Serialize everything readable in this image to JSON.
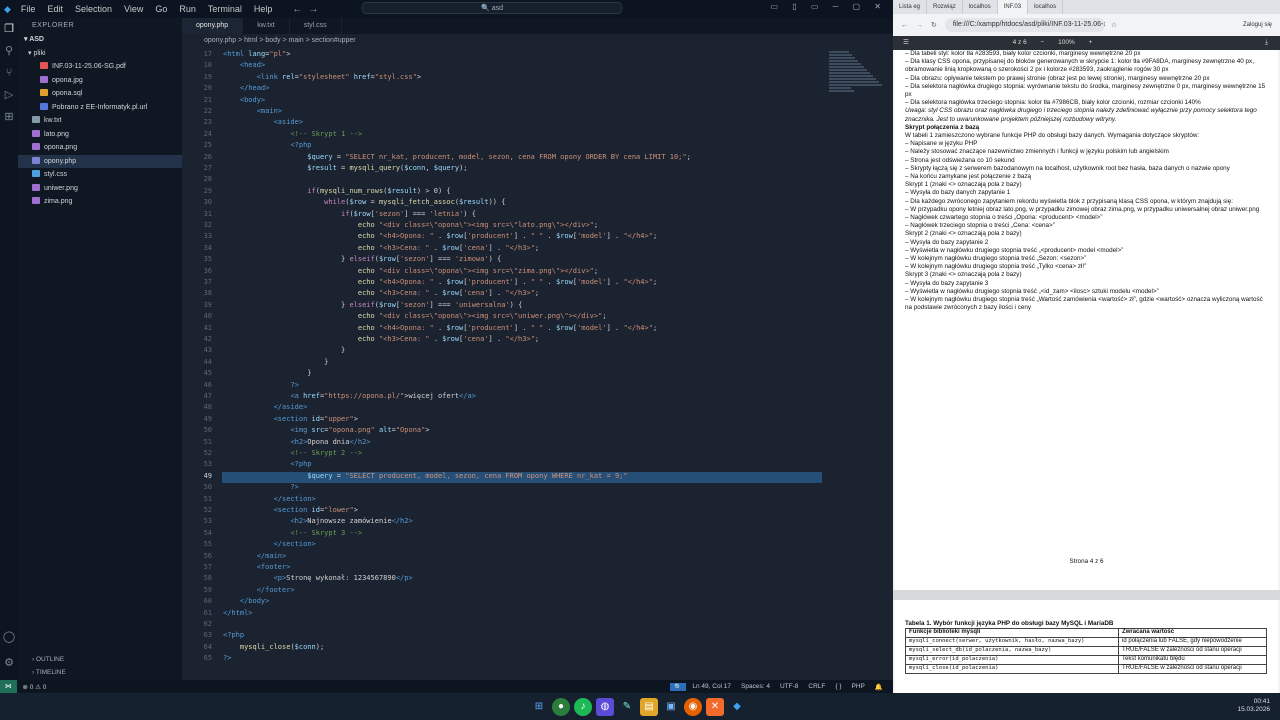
{
  "vscode": {
    "menu": [
      "File",
      "Edit",
      "Selection",
      "View",
      "Go",
      "Run",
      "Terminal",
      "Help"
    ],
    "search_text": "asd",
    "explorer_title": "EXPLORER",
    "workspace": "ASD",
    "folder": "pliki",
    "files": [
      {
        "name": "INF.03-11-25.06-SG.pdf",
        "color": "#e05555",
        "indent": true
      },
      {
        "name": "opona.jpg",
        "color": "#a070d0",
        "indent": true
      },
      {
        "name": "opona.sql",
        "color": "#e0a030",
        "indent": true
      },
      {
        "name": "Pobrano z EE-Informatyk.pl.url",
        "color": "#5577dd",
        "indent": true
      },
      {
        "name": "kw.txt",
        "color": "#8899aa",
        "indent": false
      },
      {
        "name": "lato.png",
        "color": "#a070d0",
        "indent": false
      },
      {
        "name": "opona.png",
        "color": "#a070d0",
        "indent": false
      },
      {
        "name": "opony.php",
        "color": "#7b83d6",
        "indent": false,
        "selected": true
      },
      {
        "name": "styl.css",
        "color": "#4aa0e0",
        "indent": false
      },
      {
        "name": "uniwer.png",
        "color": "#a070d0",
        "indent": false
      },
      {
        "name": "zima.png",
        "color": "#a070d0",
        "indent": false
      }
    ],
    "outline": "OUTLINE",
    "timeline": "TIMELINE",
    "tabs": [
      {
        "label": "opony.php",
        "active": true
      },
      {
        "label": "kw.txt",
        "active": false
      },
      {
        "label": "styl.css",
        "active": false
      }
    ],
    "breadcrumb": "opony.php  >  html  >  body  >  main  >  section#upper",
    "status": {
      "errors": "⊗ 0  ⚠ 0",
      "position": "Ln 49, Col 17",
      "spaces": "Spaces: 4",
      "encoding": "UTF-8",
      "eol": "CRLF",
      "brackets": "{ }",
      "language": "PHP"
    },
    "code": [
      {
        "n": "17",
        "h": "<span class='t'>&lt;html</span> <span class='v'>lang</span>=<span class='s'>\"pl\"</span>&gt;"
      },
      {
        "n": "18",
        "h": "    <span class='t'>&lt;head&gt;</span>"
      },
      {
        "n": "19",
        "h": "        <span class='t'>&lt;link</span> <span class='v'>rel</span>=<span class='s'>\"stylesheet\"</span> <span class='v'>href</span>=<span class='s'>\"styl.css\"</span>&gt;"
      },
      {
        "n": "20",
        "h": "    <span class='t'>&lt;/head&gt;</span>"
      },
      {
        "n": "21",
        "h": "    <span class='t'>&lt;body&gt;</span>"
      },
      {
        "n": "22",
        "h": "        <span class='t'>&lt;main&gt;</span>"
      },
      {
        "n": "23",
        "h": "            <span class='t'>&lt;aside&gt;</span>"
      },
      {
        "n": "24",
        "h": "                <span class='c'>&lt;!-- Skrypt 1 --&gt;</span>"
      },
      {
        "n": "25",
        "h": "                <span class='t'>&lt;?php</span>"
      },
      {
        "n": "26",
        "h": "                    <span class='v'>$query</span> = <span class='s'>\"SELECT nr_kat, producent, model, sezon, cena FROM opony ORDER BY cena LIMIT 10;\"</span>;"
      },
      {
        "n": "27",
        "h": "                    <span class='v'>$result</span> = <span class='f'>mysqli_query</span>(<span class='v'>$conn</span>, <span class='v'>$query</span>);"
      },
      {
        "n": "28",
        "h": ""
      },
      {
        "n": "29",
        "h": "                    <span class='k'>if</span>(<span class='f'>mysqli_num_rows</span>(<span class='v'>$result</span>) &gt; 0) {"
      },
      {
        "n": "30",
        "h": "                        <span class='k'>while</span>(<span class='v'>$row</span> = <span class='f'>mysqli_fetch_assoc</span>(<span class='v'>$result</span>)) {"
      },
      {
        "n": "31",
        "h": "                            <span class='k'>if</span>(<span class='v'>$row</span>[<span class='s'>'sezon'</span>] === <span class='s'>'letnia'</span>) {"
      },
      {
        "n": "32",
        "h": "                                <span class='f'>echo</span> <span class='s'>\"&lt;div class=\\\"opona\\\"&gt;&lt;img src=\\\"lato.png\\\"&gt;&lt;/div&gt;\"</span>;"
      },
      {
        "n": "33",
        "h": "                                <span class='f'>echo</span> <span class='s'>\"&lt;h4&gt;Opona: \"</span> . <span class='v'>$row</span>[<span class='s'>'producent'</span>] . <span class='s'>\" \"</span> . <span class='v'>$row</span>[<span class='s'>'model'</span>] . <span class='s'>\"&lt;/h4&gt;\"</span>;"
      },
      {
        "n": "34",
        "h": "                                <span class='f'>echo</span> <span class='s'>\"&lt;h3&gt;Cena: \"</span> . <span class='v'>$row</span>[<span class='s'>'cena'</span>] . <span class='s'>\"&lt;/h3&gt;\"</span>;"
      },
      {
        "n": "35",
        "h": "                            } <span class='k'>elseif</span>(<span class='v'>$row</span>[<span class='s'>'sezon'</span>] === <span class='s'>'zimowa'</span>) {"
      },
      {
        "n": "36",
        "h": "                                <span class='f'>echo</span> <span class='s'>\"&lt;div class=\\\"opona\\\"&gt;&lt;img src=\\\"zima.png\\\"&gt;&lt;/div&gt;\"</span>;"
      },
      {
        "n": "37",
        "h": "                                <span class='f'>echo</span> <span class='s'>\"&lt;h4&gt;Opona: \"</span> . <span class='v'>$row</span>[<span class='s'>'producent'</span>] . <span class='s'>\" \"</span> . <span class='v'>$row</span>[<span class='s'>'model'</span>] . <span class='s'>\"&lt;/h4&gt;\"</span>;"
      },
      {
        "n": "38",
        "h": "                                <span class='f'>echo</span> <span class='s'>\"&lt;h3&gt;Cena: \"</span> . <span class='v'>$row</span>[<span class='s'>'cena'</span>] . <span class='s'>\"&lt;/h3&gt;\"</span>;"
      },
      {
        "n": "39",
        "h": "                            } <span class='k'>elseif</span>(<span class='v'>$row</span>[<span class='s'>'sezon'</span>] === <span class='s'>'uniwersalna'</span>) {"
      },
      {
        "n": "40",
        "h": "                                <span class='f'>echo</span> <span class='s'>\"&lt;div class=\\\"opona\\\"&gt;&lt;img src=\\\"uniwer.png\\\"&gt;&lt;/div&gt;\"</span>;"
      },
      {
        "n": "41",
        "h": "                                <span class='f'>echo</span> <span class='s'>\"&lt;h4&gt;Opona: \"</span> . <span class='v'>$row</span>[<span class='s'>'producent'</span>] . <span class='s'>\" \"</span> . <span class='v'>$row</span>[<span class='s'>'model'</span>] . <span class='s'>\"&lt;/h4&gt;\"</span>;"
      },
      {
        "n": "42",
        "h": "                                <span class='f'>echo</span> <span class='s'>\"&lt;h3&gt;Cena: \"</span> . <span class='v'>$row</span>[<span class='s'>'cena'</span>] . <span class='s'>\"&lt;/h3&gt;\"</span>;"
      },
      {
        "n": "43",
        "h": "                            }"
      },
      {
        "n": "44",
        "h": "                        }"
      },
      {
        "n": "45",
        "h": "                    }"
      },
      {
        "n": "46",
        "h": "                <span class='t'>?&gt;</span>"
      },
      {
        "n": "47",
        "h": "                <span class='t'>&lt;a</span> <span class='v'>href</span>=<span class='s'>\"https://opona.pl/\"</span>&gt;więcej ofert<span class='t'>&lt;/a&gt;</span>"
      },
      {
        "n": "48",
        "h": "            <span class='t'>&lt;/aside&gt;</span>"
      },
      {
        "n": "49",
        "h": "            <span class='t'>&lt;section</span> <span class='v'>id</span>=<span class='s'>\"upper\"</span>&gt;"
      },
      {
        "n": "50",
        "h": "                <span class='t'>&lt;img</span> <span class='v'>src</span>=<span class='s'>\"opona.png\"</span> <span class='v'>alt</span>=<span class='s'>\"Opona\"</span>&gt;"
      },
      {
        "n": "51",
        "h": "                <span class='t'>&lt;h2&gt;</span>Opona dnia<span class='t'>&lt;/h2&gt;</span>"
      },
      {
        "n": "52",
        "h": "                <span class='c'>&lt;!-- Skrypt 2 --&gt;</span>"
      },
      {
        "n": "53",
        "h": "                <span class='t'>&lt;?php</span>"
      },
      {
        "n": "49",
        "h": "                    <span class='v'>$query</span> = <span class='s'>\"SELECT producent, model, sezon, cena FROM opony WHERE nr_kat = 9;\"</span>",
        "cur": true
      },
      {
        "n": "50",
        "h": "                <span class='t'>?&gt;</span>"
      },
      {
        "n": "51",
        "h": "            <span class='t'>&lt;/section&gt;</span>"
      },
      {
        "n": "52",
        "h": "            <span class='t'>&lt;section</span> <span class='v'>id</span>=<span class='s'>\"lower\"</span>&gt;"
      },
      {
        "n": "53",
        "h": "                <span class='t'>&lt;h2&gt;</span>Najnowsze zamówienie<span class='t'>&lt;/h2&gt;</span>"
      },
      {
        "n": "54",
        "h": "                <span class='c'>&lt;!-- Skrypt 3 --&gt;</span>"
      },
      {
        "n": "55",
        "h": "            <span class='t'>&lt;/section&gt;</span>"
      },
      {
        "n": "56",
        "h": "        <span class='t'>&lt;/main&gt;</span>"
      },
      {
        "n": "57",
        "h": "        <span class='t'>&lt;footer&gt;</span>"
      },
      {
        "n": "58",
        "h": "            <span class='t'>&lt;p&gt;</span>Stronę wykonał: 1234567890<span class='t'>&lt;/p&gt;</span>"
      },
      {
        "n": "59",
        "h": "        <span class='t'>&lt;/footer&gt;</span>"
      },
      {
        "n": "60",
        "h": "    <span class='t'>&lt;/body&gt;</span>"
      },
      {
        "n": "61",
        "h": "<span class='t'>&lt;/html&gt;</span>"
      },
      {
        "n": "62",
        "h": ""
      },
      {
        "n": "63",
        "h": "<span class='t'>&lt;?php</span>"
      },
      {
        "n": "64",
        "h": "    <span class='f'>mysqli_close</span>(<span class='v'>$conn</span>);"
      },
      {
        "n": "65",
        "h": "<span class='t'>?&gt;</span>"
      }
    ]
  },
  "browser": {
    "tabs": [
      "Lista eg",
      "Rozwiąz",
      "localhos",
      "INF.03",
      "localhos"
    ],
    "active_tab": 3,
    "url": "file:///C:/xampp/htdocs/asd/pliki/INF.03-11-25.06-SG.pdf",
    "pdf_page": "4 z 6",
    "pdf_zoom": "100%",
    "profile": "Zaloguj się",
    "page_lines": [
      {
        "t": "–   Dla tabeli styl: kolor tła #283593, biały kolor czcionki, marginesy wewnętrzne 20 px",
        "c": ""
      },
      {
        "t": "–   Dla klasy CSS opona, przypisanej do bloków generowanych w skrypcie 1: kolor tła #9FA8DA, marginesy zewnętrzne 40 px, obramowanie linią kropkowaną o szerokości 2 px i kolorze #283593, zaokrąglenie rogów 30 px",
        "c": ""
      },
      {
        "t": "–   Dla obrazu: opływanie tekstem po prawej stronie (obraz jest po lewej stronie), marginesy wewnętrzne 20 px",
        "c": ""
      },
      {
        "t": "–   Dla selektora nagłówka drugiego stopnia: wyrównanie tekstu do środka, marginesy zewnętrzne 0 px, marginesy wewnętrzne 15 px",
        "c": ""
      },
      {
        "t": "–   Dla selektora nagłówka trzeciego stopnia: kolor tła #7986CB, biały kolor czcionki, rozmiar czcionki 140%",
        "c": ""
      },
      {
        "t": " ",
        "c": ""
      },
      {
        "t": "Uwaga: styl CSS obrazu oraz nagłówka drugiego i trzeciego stopnia należy zdefiniować wyłącznie przy pomocy selektora tego znacznika. Jest to uwarunkowane projektem późniejszej rozbudowy witryny.",
        "c": "i"
      },
      {
        "t": " ",
        "c": ""
      },
      {
        "t": "Skrypt połączenia z bazą",
        "c": "b"
      },
      {
        "t": "W tabeli 1 zamieszczono wybrane funkcje PHP do obsługi bazy danych. Wymagania dotyczące skryptów:",
        "c": ""
      },
      {
        "t": "–   Napisane w języku PHP",
        "c": ""
      },
      {
        "t": "–   Należy stosować znaczące nazewnictwo zmiennych i funkcji w języku polskim lub angielskim",
        "c": ""
      },
      {
        "t": "–   Strona jest odświeżana co 10 sekund",
        "c": ""
      },
      {
        "t": "–   Skrypty łączą się z serwerem bazodanowym na localhost, użytkownik root bez hasła, baza danych o nazwie opony",
        "c": ""
      },
      {
        "t": "–   Na końcu zamykane jest połączenie z bazą",
        "c": ""
      },
      {
        "t": " ",
        "c": ""
      },
      {
        "t": "Skrypt 1 (znaki <> oznaczają pola z bazy)",
        "c": ""
      },
      {
        "t": "–   Wysyła do bazy danych zapytanie 1",
        "c": ""
      },
      {
        "t": "–   Dla każdego zwróconego zapytaniem rekordu wyświetla blok z przypisaną klasą CSS opona, w którym znajdują się:",
        "c": ""
      },
      {
        "t": "      –   W przypadku opony letniej obraz lato.png, w przypadku zimowej obraz zima.png, w przypadku uniwersalnej obraz uniwer.png",
        "c": ""
      },
      {
        "t": "      –   Nagłówek czwartego stopnia o treści „Opona: <producent> <model>”",
        "c": ""
      },
      {
        "t": "      –   Nagłówek trzeciego stopnia o treści „Cena: <cena>”",
        "c": ""
      },
      {
        "t": " ",
        "c": ""
      },
      {
        "t": "Skrypt 2 (znaki <> oznaczają pola z bazy)",
        "c": ""
      },
      {
        "t": "–   Wysyła do bazy zapytanie 2",
        "c": ""
      },
      {
        "t": "–   Wyświetla w nagłówku drugiego stopnia treść „<producent> model <model>”",
        "c": ""
      },
      {
        "t": "–   W kolejnym nagłówku drugiego stopnia treść „Sezon: <sezon>”",
        "c": ""
      },
      {
        "t": "–   W kolejnym nagłówku drugiego stopnia treść „Tylko <cena> zł!”",
        "c": ""
      },
      {
        "t": " ",
        "c": ""
      },
      {
        "t": "Skrypt 3 (znaki <> oznaczają pola z bazy)",
        "c": ""
      },
      {
        "t": "–   Wysyła do bazy zapytanie 3",
        "c": ""
      },
      {
        "t": "–   Wyświetla w nagłówku drugiego stopnia treść „<id_zam> <ilosc> sztuki modelu <model>”",
        "c": ""
      },
      {
        "t": "–   W kolejnym nagłówku drugiego stopnia treść „Wartość zamówienia <wartość> zł”, gdzie <wartość> oznacza wyliczoną wartość na podstawie zwróconych z bazy ilości i ceny",
        "c": ""
      }
    ],
    "page_footer": "Strona 4 z 6",
    "table_title": "Tabela 1. Wybór funkcji języka PHP do obsługi bazy MySQL i MariaDB",
    "table_headers": [
      "Funkcje biblioteki mysqli",
      "Zwracana wartość"
    ],
    "table_rows": [
      [
        "mysqli_connect(serwer, użytkownik, hasło, nazwa_bazy)",
        "id połączenia lub FALSE, gdy niepowodzenie"
      ],
      [
        "mysqli_select_db(id_polaczenia, nazwa_bazy)",
        "TRUE/FALSE w zależności od stanu operacji"
      ],
      [
        "mysqli_error(id_polaczenia)",
        "Tekst komunikatu błędu"
      ],
      [
        "mysqli_close(id_polaczenia)",
        "TRUE/FALSE w zależności od stanu operacji"
      ]
    ]
  },
  "taskbar": {
    "time": "00:41",
    "date": "15.03.2026"
  }
}
